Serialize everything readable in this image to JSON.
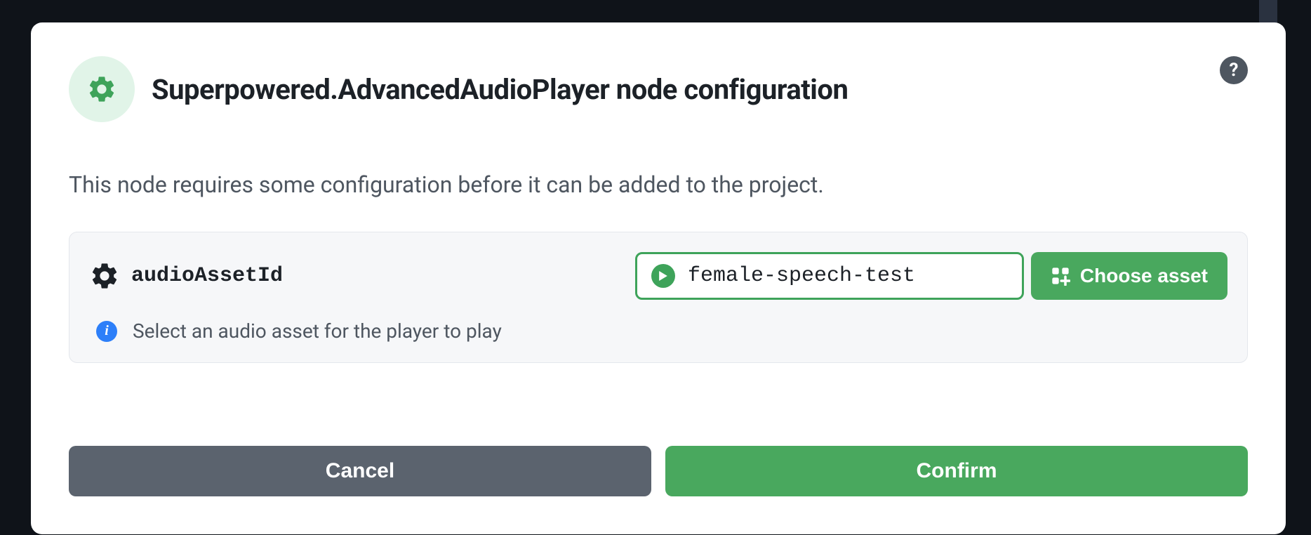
{
  "dialog": {
    "title": "Superpowered.AdvancedAudioPlayer node configuration",
    "description": "This node requires some configuration before it can be added to the project."
  },
  "config": {
    "paramName": "audioAssetId",
    "assetValue": "female-speech-test",
    "chooseLabel": "Choose asset",
    "helpText": "Select an audio asset for the player to play"
  },
  "buttons": {
    "cancel": "Cancel",
    "confirm": "Confirm"
  }
}
